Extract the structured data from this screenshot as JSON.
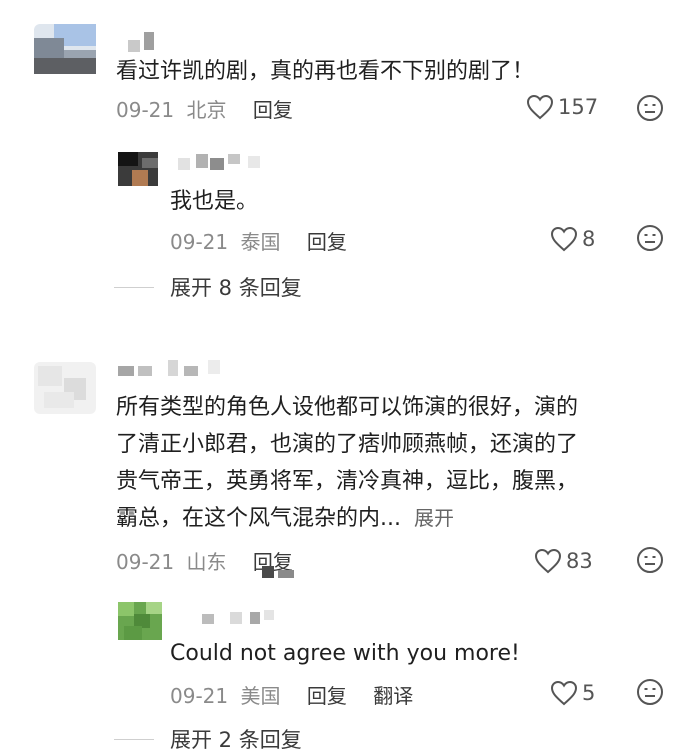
{
  "comments": [
    {
      "text": "看过许凯的剧，真的再也看不下别的剧了！",
      "date": "09-21",
      "location": "北京",
      "reply_label": "回复",
      "likes": "157",
      "replies": [
        {
          "text": "我也是。",
          "date": "09-21",
          "location": "泰国",
          "reply_label": "回复",
          "likes": "8"
        }
      ],
      "expand_label": "展开 8 条回复"
    },
    {
      "text_lines": [
        "所有类型的角色人设他都可以饰演的很好，演的",
        "了清正小郎君，也演的了痞帅顾燕帧，还演的了",
        "贵气帝王，英勇将军，清冷真神，逗比，腹黑，",
        "霸总，在这个风气混杂的内..."
      ],
      "more_label": "展开",
      "date": "09-21",
      "location": "山东",
      "reply_label": "回复",
      "likes": "83",
      "replies": [
        {
          "text": "Could not agree with you more!",
          "date": "09-21",
          "location": "美国",
          "reply_label": "回复",
          "translate_label": "翻译",
          "likes": "5"
        }
      ],
      "expand_label": "展开 2 条回复"
    }
  ],
  "icons": {
    "like": "heart-outline-icon",
    "dislike": "unhappy-face-icon"
  },
  "colors": {
    "text": "#1f1f1f",
    "meta": "#8a8a8a",
    "icon": "#555555"
  }
}
